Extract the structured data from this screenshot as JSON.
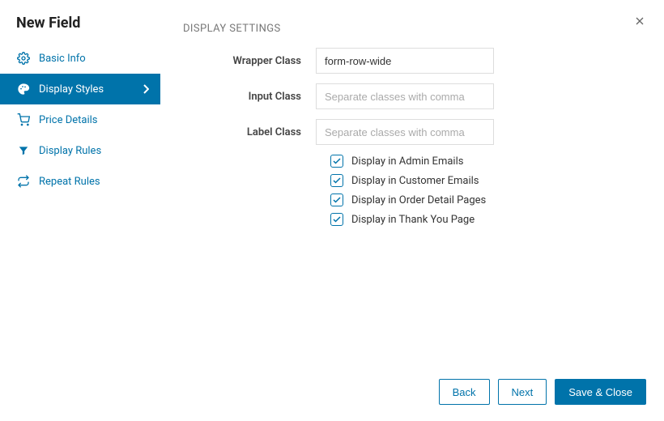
{
  "header": {
    "title": "New Field"
  },
  "sidebar": {
    "items": [
      {
        "label": "Basic Info",
        "icon": "gear-icon",
        "active": false
      },
      {
        "label": "Display Styles",
        "icon": "palette-icon",
        "active": true
      },
      {
        "label": "Price Details",
        "icon": "cart-icon",
        "active": false
      },
      {
        "label": "Display Rules",
        "icon": "funnel-icon",
        "active": false
      },
      {
        "label": "Repeat Rules",
        "icon": "repeat-icon",
        "active": false
      }
    ]
  },
  "main": {
    "section_title": "DISPLAY SETTINGS",
    "fields": {
      "wrapper_class": {
        "label": "Wrapper Class",
        "value": "form-row-wide",
        "placeholder": ""
      },
      "input_class": {
        "label": "Input Class",
        "value": "",
        "placeholder": "Separate classes with comma"
      },
      "label_class": {
        "label": "Label Class",
        "value": "",
        "placeholder": "Separate classes with comma"
      }
    },
    "checkboxes": [
      {
        "label": "Display in Admin Emails",
        "checked": true
      },
      {
        "label": "Display in Customer Emails",
        "checked": true
      },
      {
        "label": "Display in Order Detail Pages",
        "checked": true
      },
      {
        "label": "Display in Thank You Page",
        "checked": true
      }
    ]
  },
  "footer": {
    "back": "Back",
    "next": "Next",
    "save": "Save & Close"
  },
  "colors": {
    "accent": "#0073aa"
  }
}
